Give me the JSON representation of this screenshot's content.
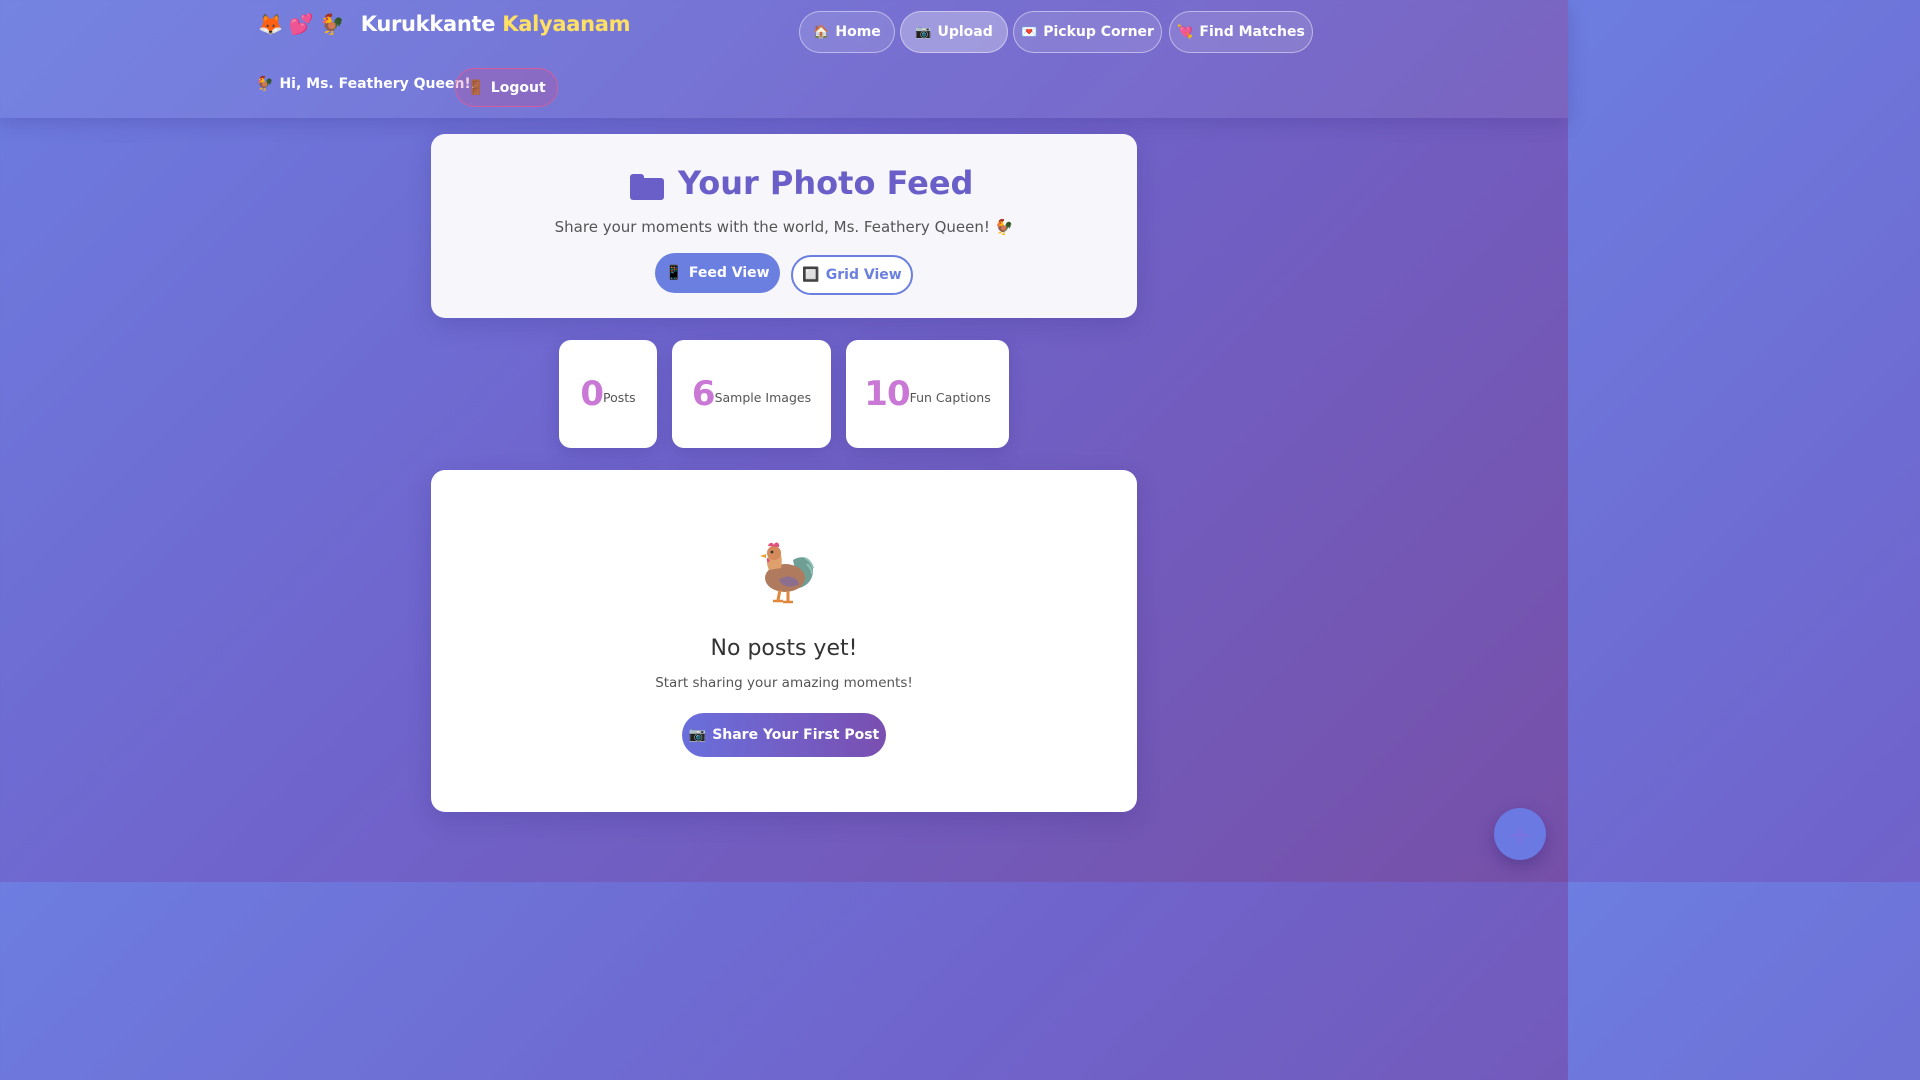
{
  "header": {
    "brand_emojis": [
      "🦊",
      "💕",
      "🐓"
    ],
    "brand_name": "Kurukkante",
    "brand_accent": "Kalyaanam",
    "nav": [
      {
        "icon": "🏠",
        "label": "Home",
        "active": false
      },
      {
        "icon": "📷",
        "label": "Upload",
        "active": true
      },
      {
        "icon": "💌",
        "label": "Pickup Corner",
        "active": false
      },
      {
        "icon": "💘",
        "label": "Find Matches",
        "active": false
      }
    ],
    "greeting_icon": "🐓",
    "greeting": "Hi, Ms. Feathery Queen!",
    "logout_icon": "🚪",
    "logout_label": "Logout"
  },
  "feed": {
    "title": "Your Photo Feed",
    "subtitle": "Share your moments with the world, Ms. Feathery Queen!",
    "subtitle_icon": "🐓",
    "feed_view_icon": "📱",
    "feed_view_label": "Feed View",
    "grid_view_icon": "🔲",
    "grid_view_label": "Grid View"
  },
  "stats": [
    {
      "value": "0",
      "label": "Posts"
    },
    {
      "value": "6",
      "label": "Sample Images"
    },
    {
      "value": "10",
      "label": "Fun Captions"
    }
  ],
  "empty_state": {
    "icon": "rooster-icon",
    "title": "No posts yet!",
    "subtitle": "Start sharing your amazing moments!",
    "button_icon": "📷",
    "button_label": "Share Your First Post"
  },
  "fab_symbol": "+",
  "colors": {
    "accent": "#6a5fc9",
    "button_blue": "#6a7fe0",
    "stat_pink": "#c978d6",
    "brand_yellow": "#ffe066"
  }
}
